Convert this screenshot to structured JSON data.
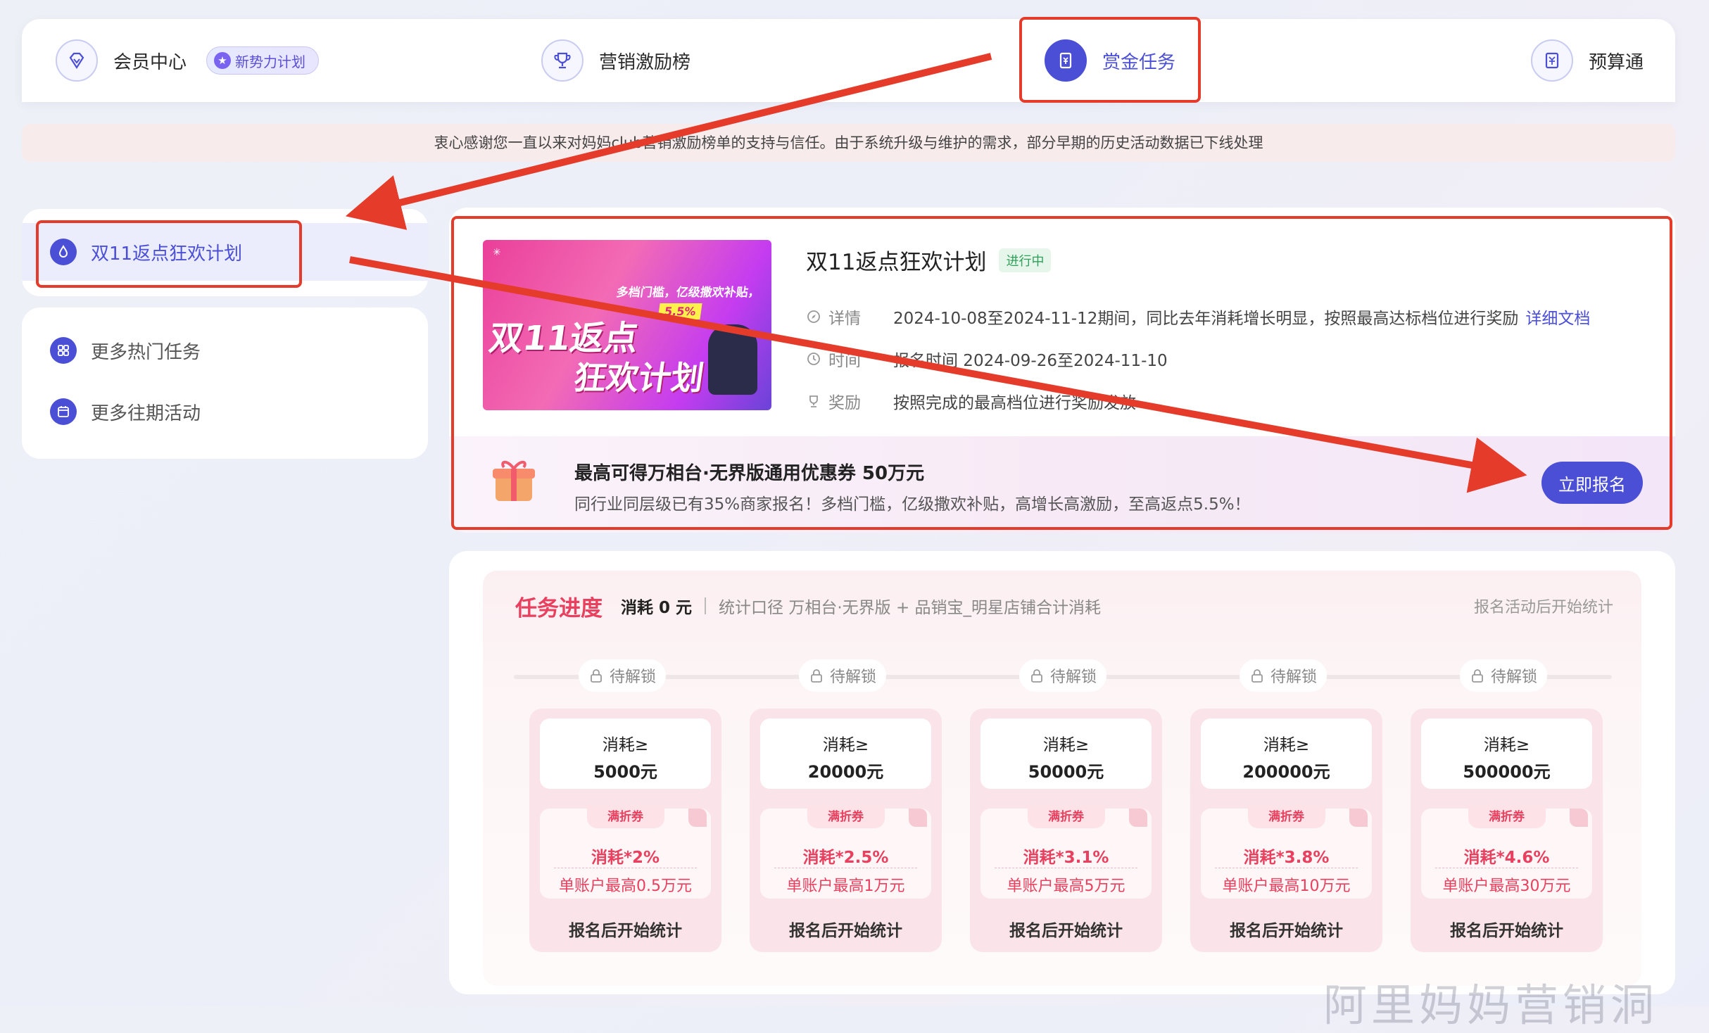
{
  "topnav": {
    "items": [
      {
        "label": "会员中心",
        "icon": "diamond-icon"
      },
      {
        "label": "营销激励榜",
        "icon": "trophy-icon"
      },
      {
        "label": "赏金任务",
        "icon": "bounty-icon",
        "active": true
      },
      {
        "label": "预算通",
        "icon": "yen-doc-icon"
      }
    ],
    "new_badge": "新势力计划"
  },
  "notice": "衷心感谢您一直以来对妈妈club营销激励榜单的支持与信任。由于系统升级与维护的需求，部分早期的历史活动数据已下线处理",
  "sidebar": {
    "active_item": "双11返点狂欢计划",
    "items": [
      {
        "label": "更多热门任务",
        "icon": "grid-icon"
      },
      {
        "label": "更多往期活动",
        "icon": "calendar-icon"
      }
    ]
  },
  "activity": {
    "banner": {
      "line1": "双11返点",
      "line2": "狂欢计划",
      "sub": "多档门槛，亿级撒欢补贴，",
      "pct": "5.5%"
    },
    "title": "双11返点狂欢计划",
    "status": "进行中",
    "rows": [
      {
        "key": "详情",
        "value": "2024-10-08至2024-11-12期间，同比去年消耗增长明显，按照最高达标档位进行奖励",
        "link": "详细文档"
      },
      {
        "key": "时间",
        "value": "报名时间 2024-09-26至2024-11-10"
      },
      {
        "key": "奖励",
        "value": "按照完成的最高档位进行奖励发放"
      }
    ],
    "reward_title": "最高可得万相台·无界版通用优惠券 50万元",
    "reward_desc": "同行业同层级已有35%商家报名！多档门槛，亿级撒欢补贴，高增长高激励，至高返点5.5%！",
    "signup_label": "立即报名"
  },
  "progress": {
    "title": "任务进度",
    "spend": "消耗 0 元",
    "scope": "统计口径 万相台·无界版 + 品销宝_明星店铺合计消耗",
    "right_note": "报名活动后开始统计",
    "lock_label": "待解锁",
    "coupon_label": "满折券",
    "tiers": [
      {
        "cond": "消耗≥",
        "amount": "5000元",
        "rate": "消耗*2%",
        "max": "单账户最高0.5万元",
        "foot": "报名后开始统计"
      },
      {
        "cond": "消耗≥",
        "amount": "20000元",
        "rate": "消耗*2.5%",
        "max": "单账户最高1万元",
        "foot": "报名后开始统计"
      },
      {
        "cond": "消耗≥",
        "amount": "50000元",
        "rate": "消耗*3.1%",
        "max": "单账户最高5万元",
        "foot": "报名后开始统计"
      },
      {
        "cond": "消耗≥",
        "amount": "200000元",
        "rate": "消耗*3.8%",
        "max": "单账户最高10万元",
        "foot": "报名后开始统计"
      },
      {
        "cond": "消耗≥",
        "amount": "500000元",
        "rate": "消耗*4.6%",
        "max": "单账户最高30万元",
        "foot": "报名后开始统计"
      }
    ]
  },
  "watermark": "阿里妈妈营销洞",
  "colors": {
    "accent": "#4b4fd6",
    "progress_red": "#e8405e",
    "annotation_red": "#e53b2b"
  }
}
